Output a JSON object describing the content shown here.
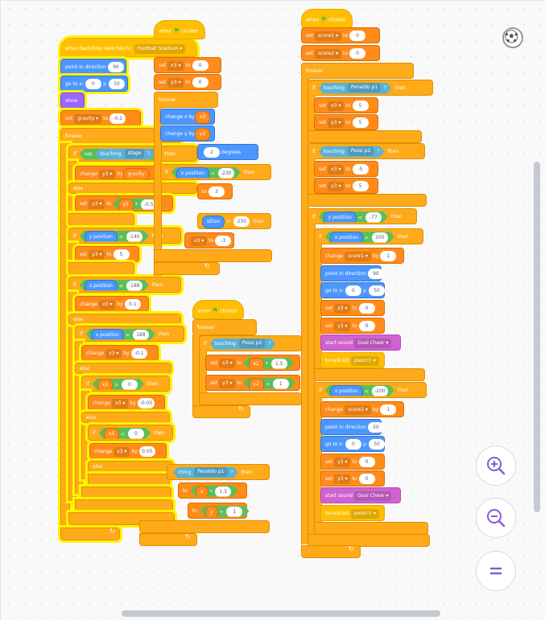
{
  "ui": {
    "colors": {
      "events": "#ffbf00",
      "control": "#ffab19",
      "variables": "#ff8c1a",
      "motion": "#4c97ff",
      "looks": "#9966ff",
      "sound": "#cf63cf",
      "operators": "#59c059",
      "sensing": "#5cb1d6"
    },
    "sprite_icon": "soccer-ball-icon",
    "zoom_in_icon": "zoom-in-icon",
    "zoom_out_icon": "zoom-out-icon",
    "reset_icon": "zoom-reset-icon"
  },
  "blocks": {
    "when_flag_clicked": "when",
    "clicked": "clicked",
    "when_backdrop": "when backdrop switches to",
    "backdrop_value": "Football Stadium",
    "point_in_direction": "point in direction",
    "dir_90": "90",
    "go_to_x": "go to x:",
    "y_label": "y:",
    "zero": "0",
    "y_50": "50",
    "show": "show",
    "set": "set",
    "to": "to",
    "gravity": "gravity",
    "gravity_val": "-0.2",
    "forever": "forever",
    "if": "if",
    "then": "then",
    "else": "else",
    "not": "not",
    "touching": "touching",
    "stage": "stage",
    "qmark": "?",
    "change": "change",
    "by": "by",
    "y3": "y3",
    "x3": "x3",
    "y3_minus": "-0.5",
    "y_position": "y position",
    "x_position": "x position",
    "lt": "<",
    "gt": ">",
    "v_minus140": "-140",
    "five": "5",
    "v_minus188": "-188",
    "v_188": "188",
    "v_0_1": "0.1",
    "v_minus0_1": "-0.1",
    "v_minus0_05": "-0.05",
    "v_0_05": "0.05",
    "change_x_by": "change x by",
    "change_y_by": "change y by",
    "two": "2",
    "degrees": "degrees",
    "v_minus230": "-230",
    "three": "3",
    "v_230": "230",
    "v_minus3": "-3",
    "penaldo": "Penaldo p1",
    "pessi": "Pessi p2",
    "x2": "x2",
    "y2": "y2",
    "x": "x",
    "y": "y",
    "v_1_5": "1.5",
    "one": "1",
    "plus": "+",
    "times": "*",
    "score1": "score1",
    "score2": "score2",
    "v_minus5": "-5",
    "v_minus77": "-77",
    "v_200": "200",
    "v_minus200": "-200",
    "start_sound": "start sound",
    "goal_cheer": "Goal Cheer",
    "broadcast": "broadcast",
    "poon": "poon!!!"
  }
}
